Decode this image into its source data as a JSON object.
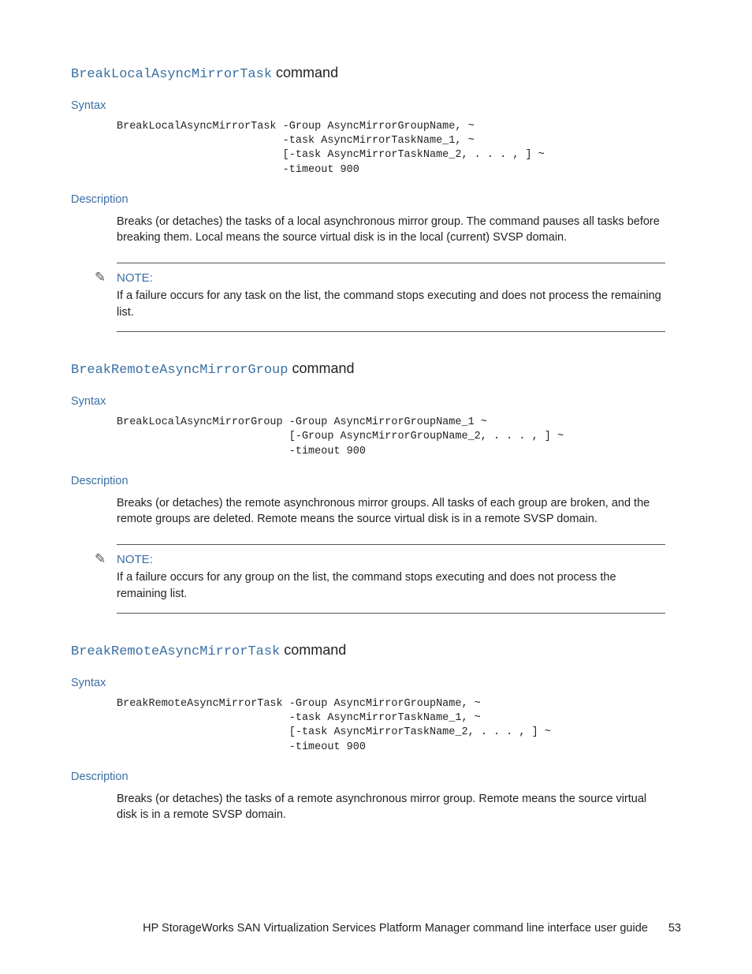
{
  "sections": [
    {
      "cmd_name": "BreakLocalAsyncMirrorTask",
      "cmd_suffix": " command",
      "syntax_label": "Syntax",
      "code": "BreakLocalAsyncMirrorTask -Group AsyncMirrorGroupName, ~\n                          -task AsyncMirrorTaskName_1, ~\n                          [-task AsyncMirrorTaskName_2, . . . , ] ~\n                          -timeout 900",
      "desc_label": "Description",
      "desc_text": "Breaks (or detaches) the tasks of a local asynchronous mirror group. The command pauses all tasks before breaking them. Local means the source virtual disk is in the local (current) SVSP domain.",
      "note_label": "NOTE:",
      "note_text": "If a failure occurs for any task on the list, the command stops executing and does not process the remaining list."
    },
    {
      "cmd_name": "BreakRemoteAsyncMirrorGroup",
      "cmd_suffix": " command",
      "syntax_label": "Syntax",
      "code": "BreakLocalAsyncMirrorGroup -Group AsyncMirrorGroupName_1 ~\n                           [-Group AsyncMirrorGroupName_2, . . . , ] ~\n                           -timeout 900",
      "desc_label": "Description",
      "desc_text": "Breaks (or detaches) the remote asynchronous mirror groups. All tasks of each group are broken, and the remote groups are deleted. Remote means the source virtual disk is in a remote SVSP domain.",
      "note_label": "NOTE:",
      "note_text": "If a failure occurs for any group on the list, the command stops executing and does not process the remaining list."
    },
    {
      "cmd_name": "BreakRemoteAsyncMirrorTask",
      "cmd_suffix": " command",
      "syntax_label": "Syntax",
      "code": "BreakRemoteAsyncMirrorTask -Group AsyncMirrorGroupName, ~\n                           -task AsyncMirrorTaskName_1, ~\n                           [-task AsyncMirrorTaskName_2, . . . , ] ~\n                           -timeout 900",
      "desc_label": "Description",
      "desc_text": "Breaks (or detaches) the tasks of a remote asynchronous mirror group. Remote means the source virtual disk is in a remote SVSP domain."
    }
  ],
  "footer": {
    "title": "HP StorageWorks SAN Virtualization Services Platform Manager command line interface user guide",
    "page": "53"
  }
}
